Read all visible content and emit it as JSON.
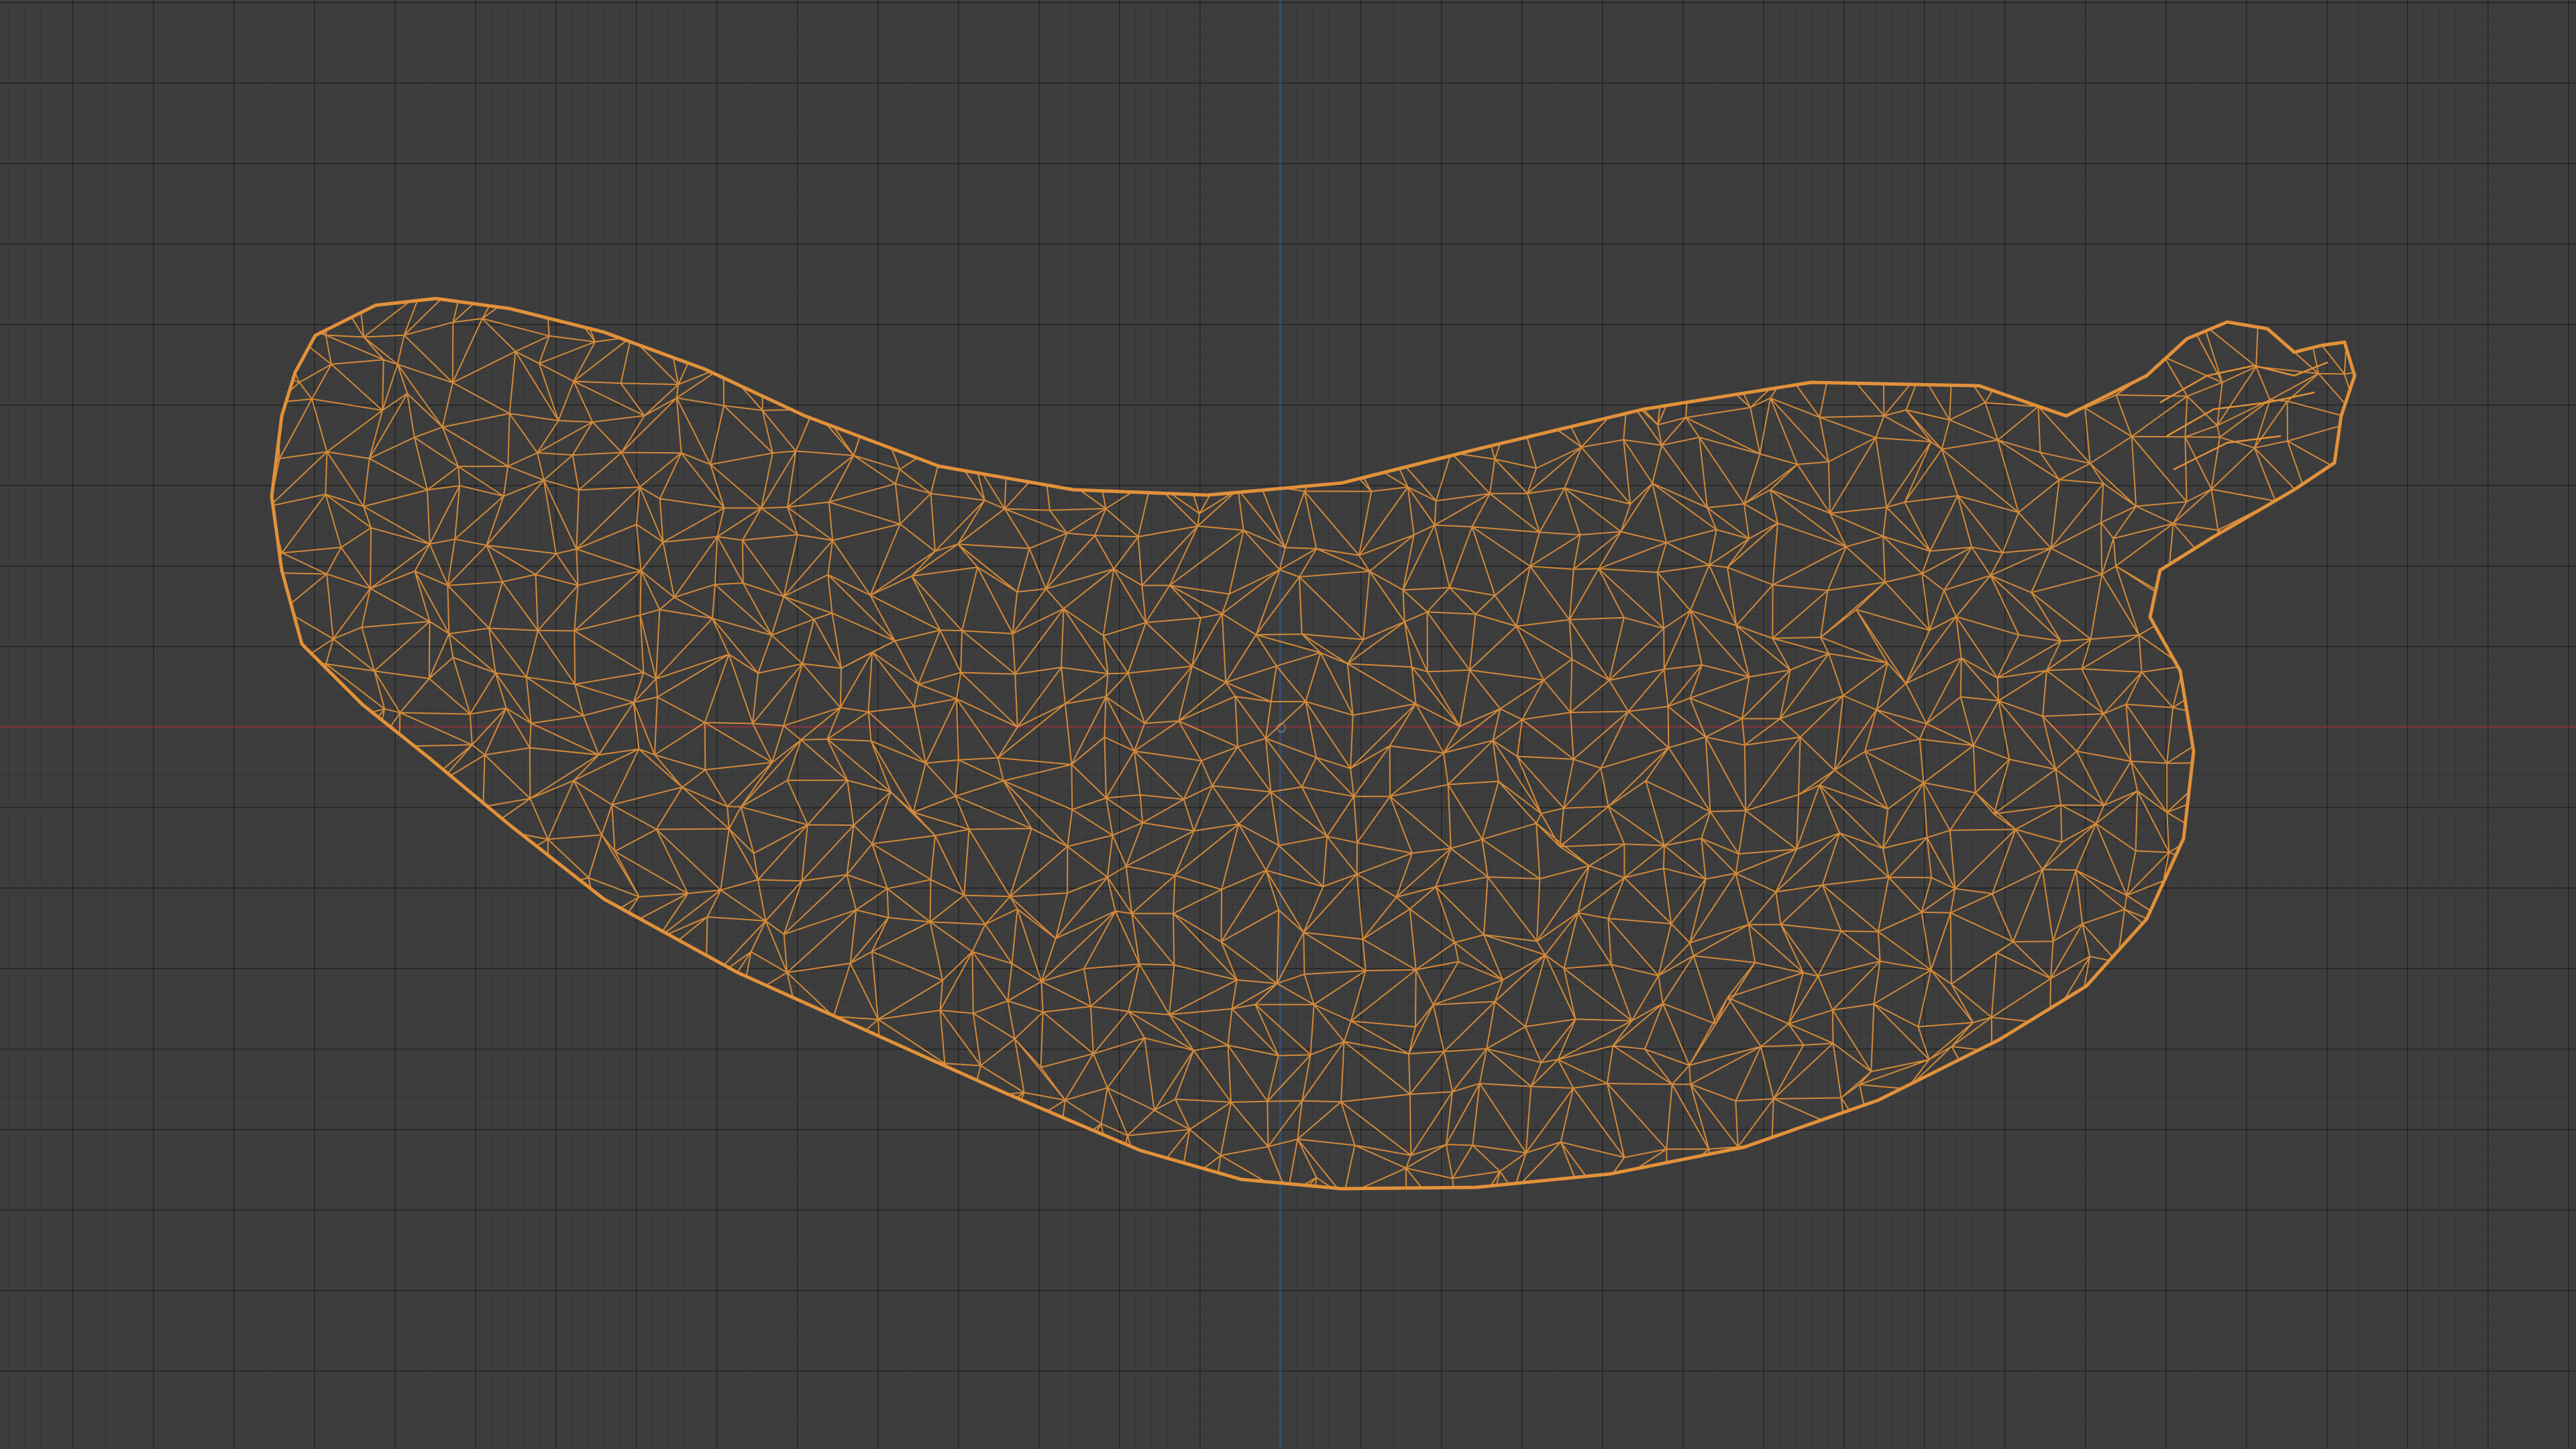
{
  "viewport": {
    "background_color": "#3d3d3d",
    "grid": "on",
    "axis_x_color": "#8b3a44",
    "axis_y_color": "#3f5a86"
  },
  "object": {
    "icon": "mesh-wireframe-icon",
    "shape": "banana",
    "display_mode": "wireframe",
    "selected": true,
    "wire_color": "#e2913a"
  }
}
